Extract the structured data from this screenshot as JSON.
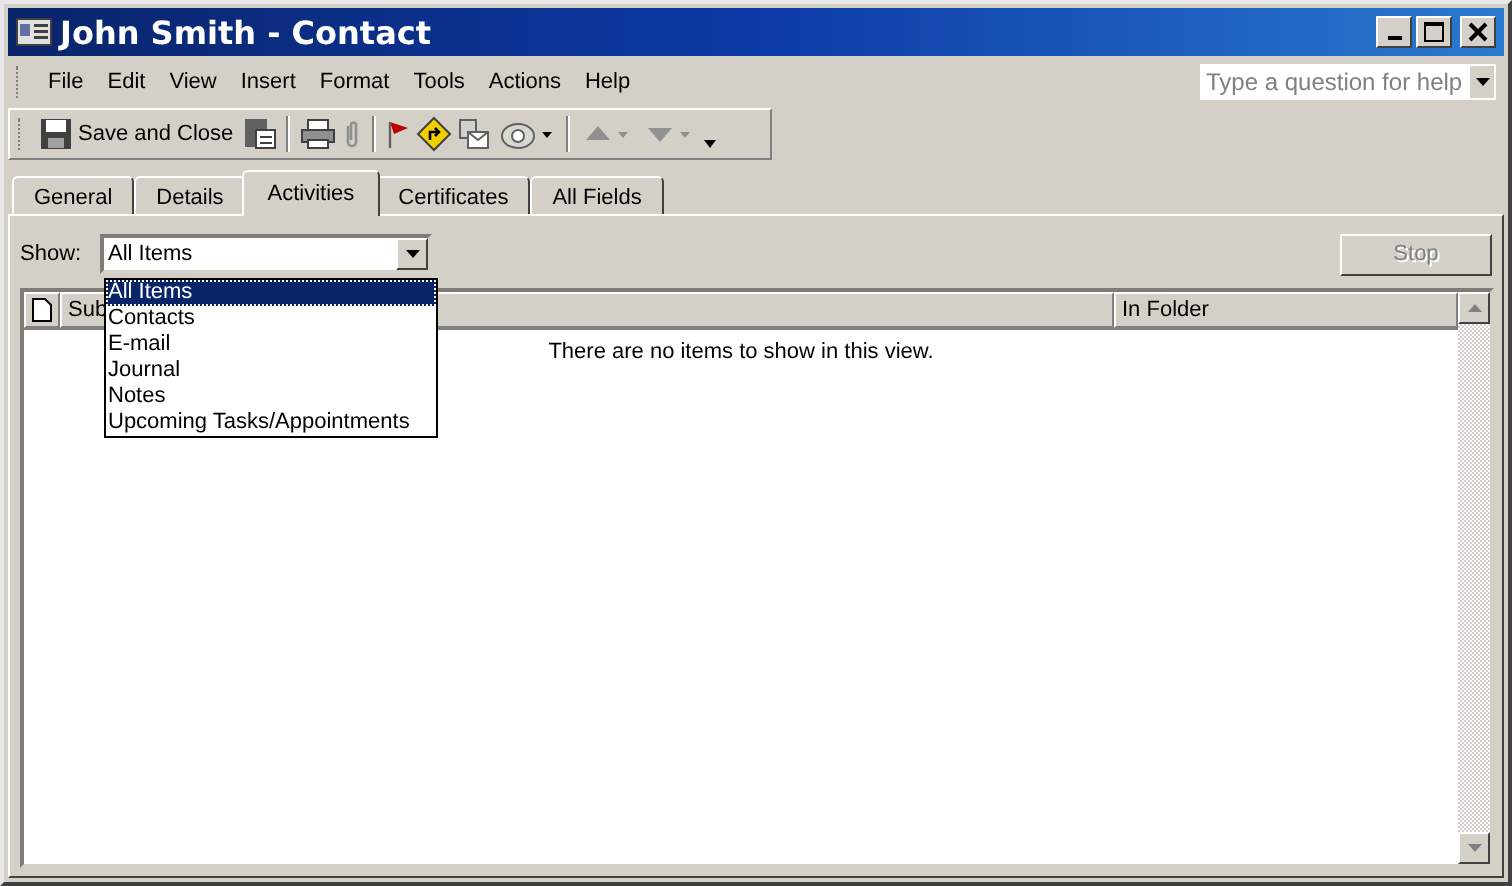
{
  "window": {
    "title": "John Smith - Contact"
  },
  "menu": [
    {
      "label": "File"
    },
    {
      "label": "Edit"
    },
    {
      "label": "View"
    },
    {
      "label": "Insert"
    },
    {
      "label": "Format"
    },
    {
      "label": "Tools"
    },
    {
      "label": "Actions"
    },
    {
      "label": "Help"
    }
  ],
  "help_box": {
    "placeholder": "Type a question for help"
  },
  "toolbar": {
    "save_label": "Save and Close"
  },
  "tabs": [
    {
      "label": "General",
      "selected": false
    },
    {
      "label": "Details",
      "selected": false
    },
    {
      "label": "Activities",
      "selected": true
    },
    {
      "label": "Certificates",
      "selected": false
    },
    {
      "label": "All Fields",
      "selected": false
    }
  ],
  "show": {
    "label": "Show:",
    "value": "All Items",
    "expanded": true,
    "options": [
      {
        "label": "All Items",
        "selected": true
      },
      {
        "label": "Contacts",
        "selected": false
      },
      {
        "label": "E-mail",
        "selected": false
      },
      {
        "label": "Journal",
        "selected": false
      },
      {
        "label": "Notes",
        "selected": false
      },
      {
        "label": "Upcoming Tasks/Appointments",
        "selected": false
      }
    ]
  },
  "stop_button": {
    "label": "Stop",
    "disabled": true
  },
  "list": {
    "columns": [
      {
        "label": "Sub"
      },
      {
        "label": "In Folder"
      }
    ],
    "empty_message": "There are no items to show in this view."
  }
}
